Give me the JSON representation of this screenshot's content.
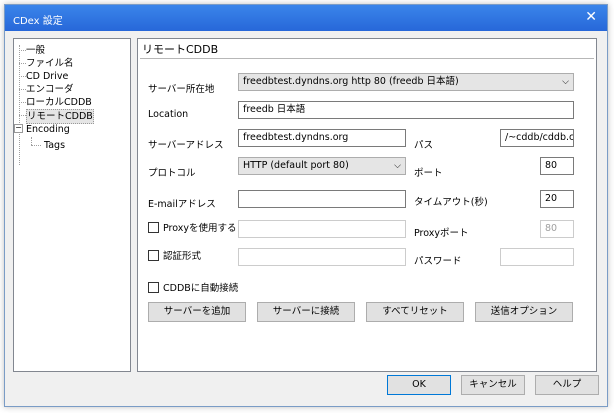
{
  "window": {
    "title": "CDex 設定",
    "close_glyph": "✕"
  },
  "tree": {
    "items": [
      {
        "label": "一般"
      },
      {
        "label": "ファイル名"
      },
      {
        "label": "CD Drive"
      },
      {
        "label": "エンコーダ"
      },
      {
        "label": "ローカルCDDB"
      },
      {
        "label": "リモートCDDB",
        "selected": true
      },
      {
        "label": "Encoding",
        "expanded": true
      },
      {
        "label": "Tags"
      }
    ],
    "expander_glyph": "−"
  },
  "panel": {
    "title": "リモートCDDB",
    "server_location_label": "サーバー所在地",
    "server_location_value": "freedbtest.dyndns.org http  80  (freedb 日本語)",
    "location_label": "Location",
    "location_value": "freedb 日本語",
    "server_address_label": "サーバーアドレス",
    "server_address_value": "freedbtest.dyndns.org",
    "path_label": "パス",
    "path_value": "/~cddb/cddb.cgi",
    "protocol_label": "プロトコル",
    "protocol_value": "HTTP (default port 80)",
    "port_label": "ポート",
    "port_value": "80",
    "email_label": "E-mailアドレス",
    "email_value": "",
    "timeout_label": "タイムアウト(秒)",
    "timeout_value": "20",
    "use_proxy_label": "Proxyを使用する",
    "use_proxy_checked": false,
    "proxy_port_label": "Proxyポート",
    "proxy_port_value": "80",
    "auth_label": "認証形式",
    "auth_checked": false,
    "password_label": "パスワード",
    "auto_connect_label": "CDDBに自動接続",
    "auto_connect_checked": false,
    "dropdown_arrow": "⌵",
    "buttons": {
      "add_server": "サーバーを追加",
      "connect_server": "サーバーに接続",
      "reset_all": "すべてリセット",
      "send_options": "送信オプション"
    }
  },
  "footer": {
    "ok": "OK",
    "cancel": "キャンセル",
    "help": "ヘルプ"
  },
  "colors": {
    "titlebar": "#2b78e4",
    "window_bg": "#f0f0f0",
    "default_button_border": "#0078d7"
  }
}
